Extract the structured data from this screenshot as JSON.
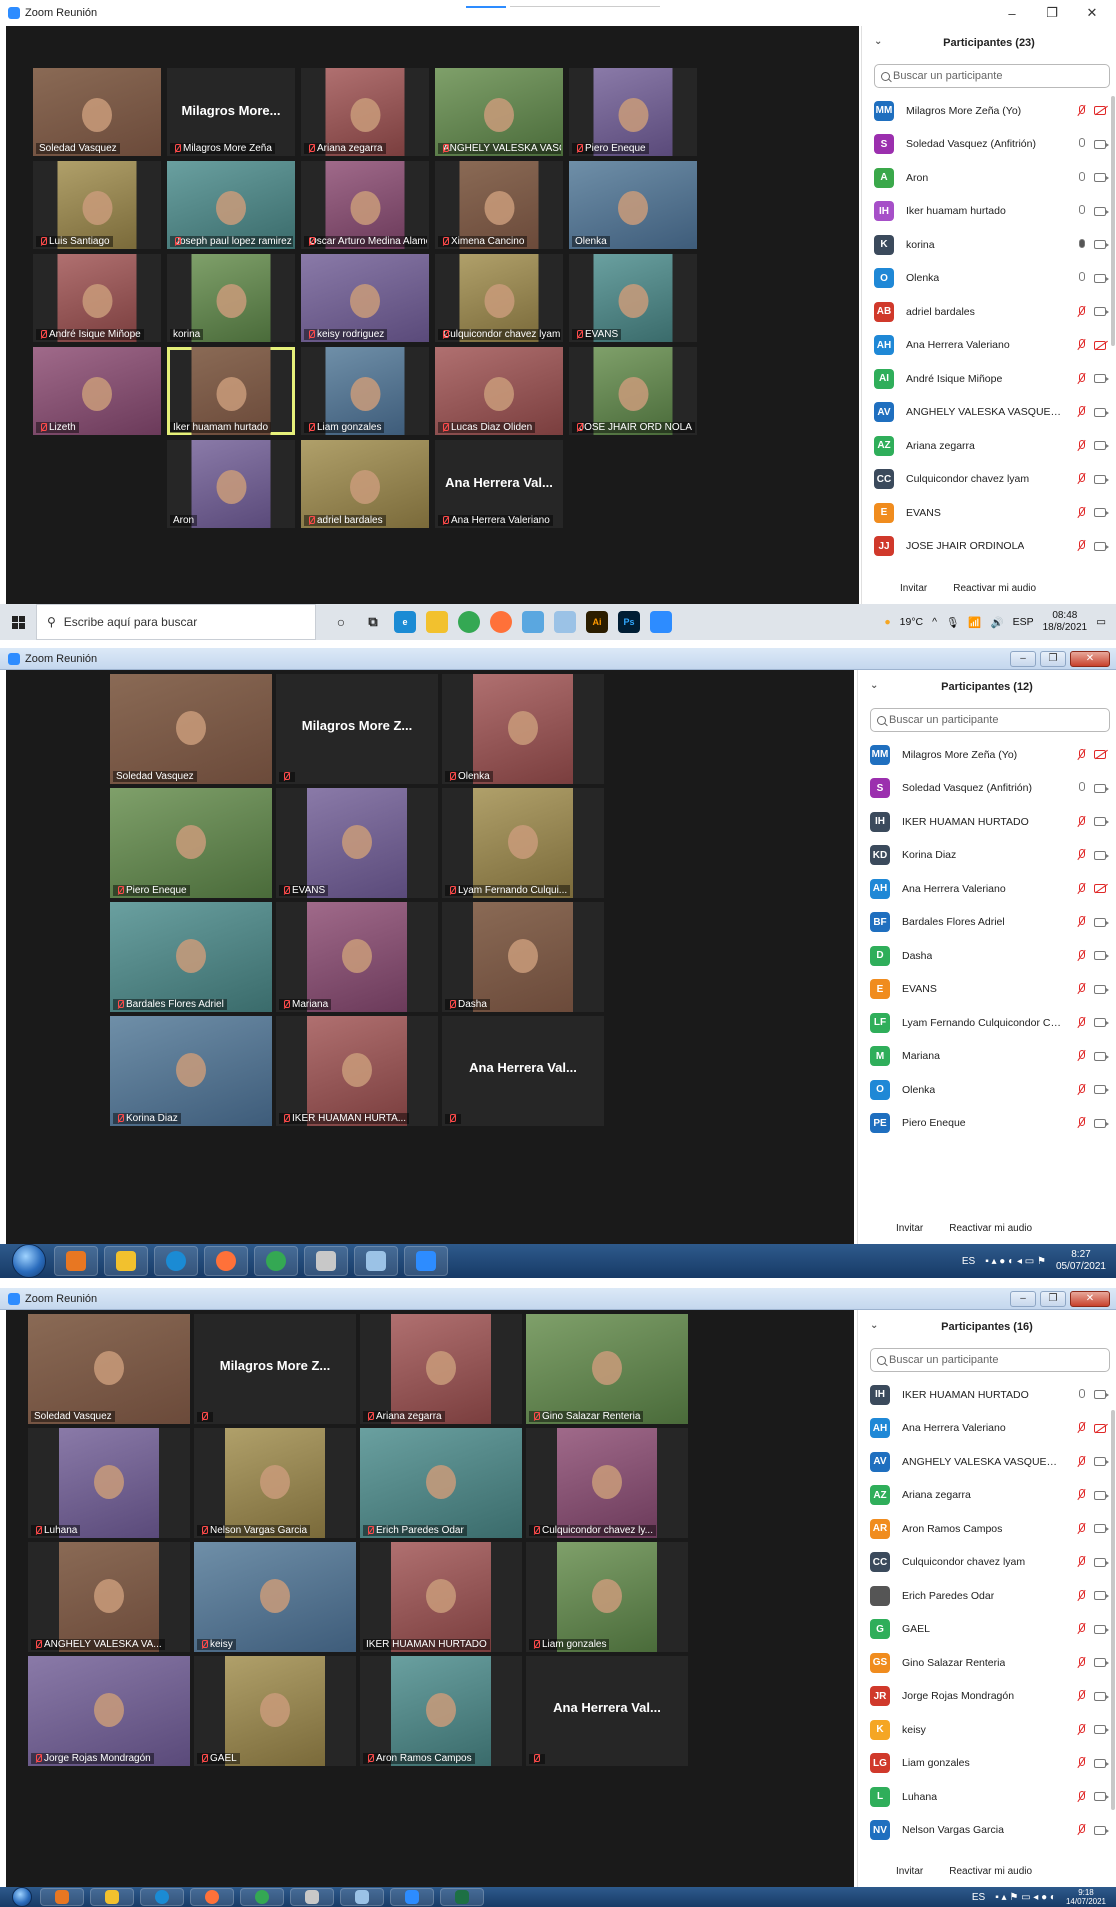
{
  "app_title": "Zoom Reunión",
  "colors": {
    "zoom_blue": "#2d8cff",
    "video_bg": "#1a1a1a",
    "active_speaker": "#e6f07a",
    "mute_red": "#e02828"
  },
  "screens": [
    {
      "participants_title": "Participantes (23)",
      "search_placeholder": "Buscar un participante",
      "footer": {
        "invite": "Invitar",
        "unmute": "Reactivar mi audio"
      },
      "participants": [
        {
          "initials": "MM",
          "name": "Milagros More Zeña (Yo)",
          "color": "#1f6fbf",
          "mic": "off",
          "cam": "off"
        },
        {
          "initials": "S",
          "name": "Soledad Vasquez (Anfitrión)",
          "color": "#9b2fae",
          "mic": "on",
          "cam": "on"
        },
        {
          "initials": "A",
          "name": "Aron",
          "color": "#3aa84a",
          "mic": "on",
          "cam": "on"
        },
        {
          "initials": "IH",
          "name": "Iker huamam hurtado",
          "color": "#a64fc8",
          "mic": "on",
          "cam": "on"
        },
        {
          "initials": "K",
          "name": "korina",
          "color": "#3b4a5c",
          "mic": "talk",
          "cam": "on"
        },
        {
          "initials": "O",
          "name": "Olenka",
          "color": "#1f88d6",
          "mic": "on",
          "cam": "on"
        },
        {
          "initials": "AB",
          "name": "adriel bardales",
          "color": "#d0392b",
          "mic": "off",
          "cam": "on"
        },
        {
          "initials": "AH",
          "name": "Ana Herrera Valeriano",
          "color": "#1f88d6",
          "mic": "off",
          "cam": "off"
        },
        {
          "initials": "AI",
          "name": "André Isique Miñope",
          "color": "#2fae5a",
          "mic": "off",
          "cam": "on"
        },
        {
          "initials": "AV",
          "name": "ANGHELY VALESKA VASQUEZ M...",
          "color": "#1f6fbf",
          "mic": "off",
          "cam": "on"
        },
        {
          "initials": "AZ",
          "name": "Ariana zegarra",
          "color": "#2fae5a",
          "mic": "off",
          "cam": "on"
        },
        {
          "initials": "CC",
          "name": "Culquicondor chavez lyam",
          "color": "#3b4a5c",
          "mic": "off",
          "cam": "on"
        },
        {
          "initials": "E",
          "name": "EVANS",
          "color": "#f08c1e",
          "mic": "off",
          "cam": "on"
        },
        {
          "initials": "JJ",
          "name": "JOSE JHAIR ORDINOLA",
          "color": "#d0392b",
          "mic": "off",
          "cam": "on"
        }
      ],
      "tiles": [
        {
          "name": "Soledad Vasquez",
          "muted": false,
          "photo": true
        },
        {
          "name": "Milagros More Zeña",
          "muted": true,
          "photo": false,
          "big": "Milagros  More..."
        },
        {
          "name": "Ariana zegarra",
          "muted": true,
          "photo": true
        },
        {
          "name": "ANGHELY VALESKA VASQU...",
          "muted": true,
          "photo": true
        },
        {
          "name": "Piero Eneque",
          "muted": true,
          "photo": true
        },
        {
          "name": "Luis Santiago",
          "muted": true,
          "photo": true
        },
        {
          "name": "Joseph paul lopez ramirez",
          "muted": true,
          "photo": true
        },
        {
          "name": "Oscar Arturo Medina Alamo",
          "muted": true,
          "photo": true
        },
        {
          "name": "Ximena Cancino",
          "muted": true,
          "photo": true
        },
        {
          "name": "Olenka",
          "muted": false,
          "photo": true
        },
        {
          "name": "André Isique Miñope",
          "muted": true,
          "photo": true
        },
        {
          "name": "korina",
          "muted": false,
          "photo": true
        },
        {
          "name": "keisy rodriguez",
          "muted": true,
          "photo": true
        },
        {
          "name": "Culquicondor chavez lyam",
          "muted": true,
          "photo": true
        },
        {
          "name": "EVANS",
          "muted": true,
          "photo": true
        },
        {
          "name": "Lizeth",
          "muted": true,
          "photo": true
        },
        {
          "name": "Iker huamam hurtado",
          "muted": false,
          "photo": true
        },
        {
          "name": "Liam gonzales",
          "muted": true,
          "photo": true
        },
        {
          "name": "Lucas Diaz Oliden",
          "muted": true,
          "photo": true
        },
        {
          "name": "JOSE JHAIR ORD NOLA",
          "muted": true,
          "photo": true
        },
        {
          "name": "Aron",
          "muted": false,
          "photo": true
        },
        {
          "name": "adriel bardales",
          "muted": true,
          "photo": true
        },
        {
          "name": "Ana Herrera Valeriano",
          "muted": true,
          "photo": false,
          "big": "Ana Herrera Val..."
        }
      ],
      "taskbar": {
        "search_placeholder": "Escribe aquí para buscar",
        "temp": "19°C",
        "lang": "ESP",
        "time": "08:48",
        "date": "18/8/2021"
      }
    },
    {
      "participants_title": "Participantes (12)",
      "search_placeholder": "Buscar un participante",
      "footer": {
        "invite": "Invitar",
        "unmute": "Reactivar mi audio"
      },
      "participants": [
        {
          "initials": "MM",
          "name": "Milagros More Zeña (Yo)",
          "color": "#1f6fbf",
          "mic": "off",
          "cam": "off"
        },
        {
          "initials": "S",
          "name": "Soledad Vasquez (Anfitrión)",
          "color": "#9b2fae",
          "mic": "on",
          "cam": "on"
        },
        {
          "initials": "IH",
          "name": "IKER HUAMAN HURTADO",
          "color": "#3b4a5c",
          "mic": "off",
          "cam": "on"
        },
        {
          "initials": "KD",
          "name": "Korina Diaz",
          "color": "#3b4a5c",
          "mic": "off",
          "cam": "on"
        },
        {
          "initials": "AH",
          "name": "Ana Herrera Valeriano",
          "color": "#1f88d6",
          "mic": "off",
          "cam": "off"
        },
        {
          "initials": "BF",
          "name": "Bardales Flores Adriel",
          "color": "#1f6fbf",
          "mic": "off",
          "cam": "on"
        },
        {
          "initials": "D",
          "name": "Dasha",
          "color": "#2fae5a",
          "mic": "off",
          "cam": "on"
        },
        {
          "initials": "E",
          "name": "EVANS",
          "color": "#f08c1e",
          "mic": "off",
          "cam": "on"
        },
        {
          "initials": "LF",
          "name": "Lyam Fernando Culquicondor Ch...",
          "color": "#2fae5a",
          "mic": "off",
          "cam": "on"
        },
        {
          "initials": "M",
          "name": "Mariana",
          "color": "#2fae5a",
          "mic": "off",
          "cam": "on"
        },
        {
          "initials": "O",
          "name": "Olenka",
          "color": "#1f88d6",
          "mic": "off",
          "cam": "on"
        },
        {
          "initials": "PE",
          "name": "Piero Eneque",
          "color": "#1f6fbf",
          "mic": "off",
          "cam": "on"
        }
      ],
      "tiles": [
        {
          "name": "Soledad Vasquez",
          "muted": false,
          "photo": true
        },
        {
          "name": "",
          "muted": true,
          "photo": false,
          "big": "Milagros More Z..."
        },
        {
          "name": "Olenka",
          "muted": true,
          "photo": true
        },
        {
          "name": "Piero Eneque",
          "muted": true,
          "photo": true
        },
        {
          "name": "EVANS",
          "muted": true,
          "photo": true
        },
        {
          "name": "Lyam Fernando Culqui...",
          "muted": true,
          "photo": true
        },
        {
          "name": "Bardales Flores Adriel",
          "muted": true,
          "photo": true
        },
        {
          "name": "Mariana",
          "muted": true,
          "photo": true
        },
        {
          "name": "Dasha",
          "muted": true,
          "photo": true
        },
        {
          "name": "Korina Diaz",
          "muted": true,
          "photo": true
        },
        {
          "name": "IKER HUAMAN HURTA...",
          "muted": true,
          "photo": true
        },
        {
          "name": "",
          "muted": true,
          "photo": false,
          "big": "Ana Herrera Val..."
        }
      ],
      "taskbar": {
        "lang": "ES",
        "time": "8:27",
        "date": "05/07/2021"
      }
    },
    {
      "participants_title": "Participantes (16)",
      "search_placeholder": "Buscar un participante",
      "footer": {
        "invite": "Invitar",
        "unmute": "Reactivar mi audio"
      },
      "participants": [
        {
          "initials": "IH",
          "name": "IKER HUAMAN HURTADO",
          "color": "#3b4a5c",
          "mic": "on",
          "cam": "on"
        },
        {
          "initials": "AH",
          "name": "Ana Herrera Valeriano",
          "color": "#1f88d6",
          "mic": "off",
          "cam": "off"
        },
        {
          "initials": "AV",
          "name": "ANGHELY VALESKA VASQUEZ ...",
          "color": "#1f6fbf",
          "mic": "off",
          "cam": "on"
        },
        {
          "initials": "AZ",
          "name": "Ariana  zegarra",
          "color": "#2fae5a",
          "mic": "off",
          "cam": "on"
        },
        {
          "initials": "AR",
          "name": "Aron Ramos Campos",
          "color": "#f08c1e",
          "mic": "off",
          "cam": "on"
        },
        {
          "initials": "CC",
          "name": "Culquicondor chavez lyam",
          "color": "#3b4a5c",
          "mic": "off",
          "cam": "on"
        },
        {
          "initials": "",
          "name": "Erich Paredes Odar",
          "color": "#555555",
          "mic": "off",
          "cam": "on"
        },
        {
          "initials": "G",
          "name": "GAEL",
          "color": "#2fae5a",
          "mic": "off",
          "cam": "on"
        },
        {
          "initials": "GS",
          "name": "Gino Salazar Renteria",
          "color": "#f08c1e",
          "mic": "off",
          "cam": "on"
        },
        {
          "initials": "JR",
          "name": "Jorge Rojas Mondragón",
          "color": "#d0392b",
          "mic": "off",
          "cam": "on"
        },
        {
          "initials": "K",
          "name": "keisy",
          "color": "#f5a623",
          "mic": "off",
          "cam": "on"
        },
        {
          "initials": "LG",
          "name": "Liam gonzales",
          "color": "#d0392b",
          "mic": "off",
          "cam": "on"
        },
        {
          "initials": "L",
          "name": "Luhana",
          "color": "#2fae5a",
          "mic": "off",
          "cam": "on"
        },
        {
          "initials": "NV",
          "name": "Nelson  Vargas Garcia",
          "color": "#1f6fbf",
          "mic": "off",
          "cam": "on"
        }
      ],
      "tiles": [
        {
          "name": "Soledad Vasquez",
          "muted": false,
          "photo": true
        },
        {
          "name": "",
          "muted": true,
          "photo": false,
          "big": "Milagros More Z..."
        },
        {
          "name": "Ariana  zegarra",
          "muted": true,
          "photo": true
        },
        {
          "name": "Gino Salazar Renteria",
          "muted": true,
          "photo": true
        },
        {
          "name": "Luhana",
          "muted": true,
          "photo": true
        },
        {
          "name": "Nelson  Vargas Garcia",
          "muted": true,
          "photo": true
        },
        {
          "name": "Erich Paredes Odar",
          "muted": true,
          "photo": true
        },
        {
          "name": "Culquicondor chavez ly...",
          "muted": true,
          "photo": true
        },
        {
          "name": "ANGHELY VALESKA VA...",
          "muted": true,
          "photo": true
        },
        {
          "name": "keisy",
          "muted": true,
          "photo": true
        },
        {
          "name": "IKER HUAMAN HURTADO",
          "muted": false,
          "photo": true
        },
        {
          "name": "Liam gonzales",
          "muted": true,
          "photo": true
        },
        {
          "name": "Jorge Rojas Mondragón",
          "muted": true,
          "photo": true
        },
        {
          "name": "GAEL",
          "muted": true,
          "photo": true
        },
        {
          "name": "Aron Ramos Campos",
          "muted": true,
          "photo": true
        },
        {
          "name": "",
          "muted": true,
          "photo": false,
          "big": "Ana Herrera Val..."
        }
      ],
      "taskbar": {
        "lang": "ES",
        "time": "9:18",
        "date": "14/07/2021"
      }
    }
  ]
}
